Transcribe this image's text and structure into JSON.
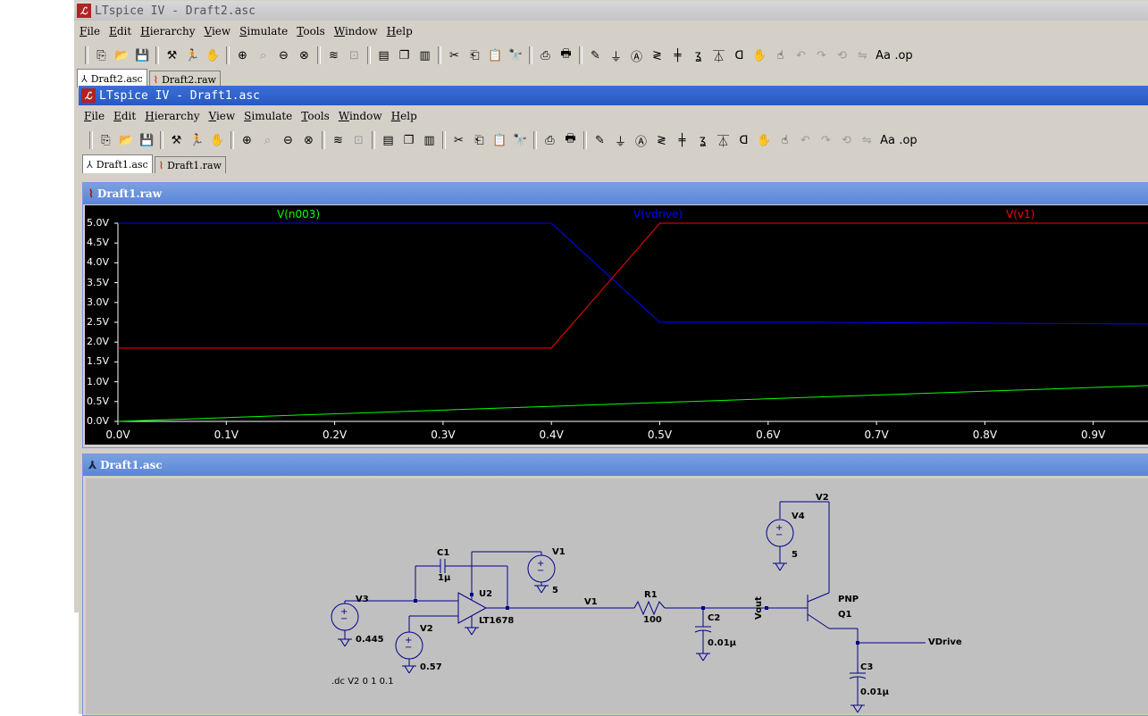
{
  "outer": {
    "title": "LTspice IV - Draft2.asc",
    "menu": [
      "File",
      "Edit",
      "Hierarchy",
      "View",
      "Simulate",
      "Tools",
      "Window",
      "Help"
    ],
    "tabs": [
      {
        "label": "Draft2.asc",
        "icon": "schematic-icon",
        "active": true
      },
      {
        "label": "Draft2.raw",
        "icon": "waveform-icon",
        "active": false
      }
    ]
  },
  "inner": {
    "title": "LTspice IV - Draft1.asc",
    "menu": [
      "File",
      "Edit",
      "Hierarchy",
      "View",
      "Simulate",
      "Tools",
      "Window",
      "Help"
    ],
    "tabs": [
      {
        "label": "Draft1.asc",
        "icon": "schematic-icon",
        "active": true
      },
      {
        "label": "Draft1.raw",
        "icon": "waveform-icon",
        "active": false
      }
    ]
  },
  "toolbar_icons": [
    "new-schematic-icon",
    "open-icon",
    "save-icon",
    "control-panel-icon",
    "run-icon",
    "halt-icon",
    "zoom-in-icon",
    "zoom-pan-icon",
    "zoom-out-icon",
    "zoom-fit-icon",
    "autorange-icon",
    "cross-icon",
    "tile-horizontal-icon",
    "cascade-icon",
    "tile-vertical-icon",
    "cut-icon",
    "copy-icon",
    "paste-icon",
    "find-icon",
    "print-setup-icon",
    "print-icon",
    "draw-wire-icon",
    "ground-icon",
    "label-net-icon",
    "resistor-icon",
    "capacitor-icon",
    "inductor-icon",
    "diode-icon",
    "component-icon",
    "move-icon",
    "drag-icon",
    "undo-icon",
    "redo-icon",
    "rotate-icon",
    "mirror-icon",
    "text-icon",
    "spice-directive-icon"
  ],
  "waveform_window": {
    "title": "Draft1.raw",
    "traces": [
      {
        "name": "V(n003)",
        "color": "#00ff00"
      },
      {
        "name": "V(vdrive)",
        "color": "#0000ff"
      },
      {
        "name": "V(v1)",
        "color": "#ff0000"
      }
    ]
  },
  "chart_data": {
    "type": "line",
    "x_ticks": [
      "0.0V",
      "0.1V",
      "0.2V",
      "0.3V",
      "0.4V",
      "0.5V",
      "0.6V",
      "0.7V",
      "0.8V",
      "0.9V"
    ],
    "y_ticks": [
      "0.0V",
      "0.5V",
      "1.0V",
      "1.5V",
      "2.0V",
      "2.5V",
      "3.0V",
      "3.5V",
      "4.0V",
      "4.5V",
      "5.0V"
    ],
    "xlim": [
      0,
      1.0
    ],
    "ylim": [
      0,
      5.0
    ],
    "series": [
      {
        "name": "V(n003)",
        "color": "#00ff00",
        "x": [
          0,
          1.0
        ],
        "y": [
          0,
          0.95
        ]
      },
      {
        "name": "V(vdrive)",
        "color": "#0000ff",
        "x": [
          0,
          0.4,
          0.5,
          0.65,
          1.0
        ],
        "y": [
          5.0,
          5.0,
          2.5,
          2.5,
          2.45
        ]
      },
      {
        "name": "V(v1)",
        "color": "#ff0000",
        "x": [
          0,
          0.4,
          0.5,
          1.0
        ],
        "y": [
          1.85,
          1.85,
          5.0,
          5.0
        ]
      }
    ]
  },
  "schematic_window": {
    "title": "Draft1.asc",
    "labels": {
      "v2_net": "V2",
      "v4": "V4",
      "v4_val": "5",
      "c1": "C1",
      "c1_val": "1µ",
      "v1": "V1",
      "v1_val": "5",
      "u2": "U2",
      "u2_part": "LT1678",
      "v3": "V3",
      "v3_val": "0.445",
      "v2": "V2",
      "v2_val": "0.57",
      "v1_net": "V1",
      "r1": "R1",
      "r1_val": "100",
      "c2": "C2",
      "c2_val": "0.01µ",
      "vout": "Vout",
      "q1_model": "PNP",
      "q1": "Q1",
      "vdrive": "VDrive",
      "c3": "C3",
      "c3_val": "0.01µ",
      "directive": ".dc V2 0 1 0.1"
    }
  }
}
